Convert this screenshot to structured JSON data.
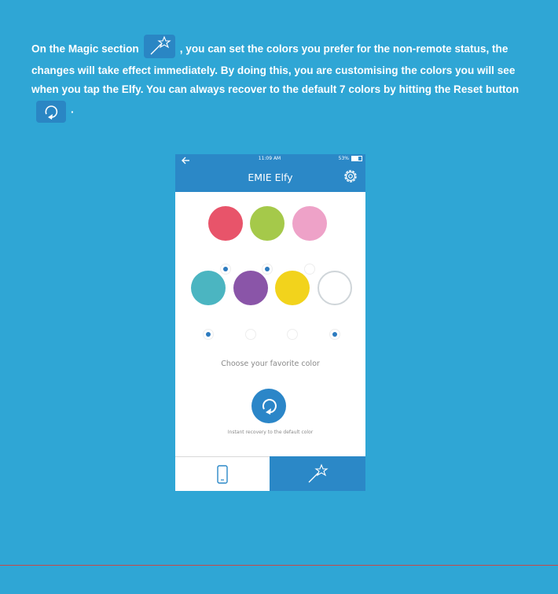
{
  "instructions": {
    "part1": "On the Magic section",
    "part2": ", you can set the colors you prefer for the non-remote status, the changes will take effect immediately. By doing this, you are customising the colors you will see when you tap the Elfy. You can always recover to the default 7 colors by hitting the Reset button",
    "part3": ".",
    "magic_icon": "magic-wand-icon",
    "reset_icon": "reset-icon"
  },
  "phone": {
    "status_time": "11:09 AM",
    "status_battery": "53%",
    "app_title": "EMIE Elfy",
    "settings_icon": "gear-icon",
    "colors": [
      {
        "color": "#e8546a",
        "selected": true
      },
      {
        "color": "#a5c94a",
        "selected": true
      },
      {
        "color": "#eea2c8",
        "selected": false
      },
      {
        "color": "#4bb5c1",
        "selected": true
      },
      {
        "color": "#8a55a8",
        "selected": false
      },
      {
        "color": "#f2d31c",
        "selected": false
      },
      {
        "color": "#ffffff",
        "selected": true
      }
    ],
    "choose_label": "Choose your favorite color",
    "recovery_label": "Instant recovery to the default color",
    "tabs": [
      {
        "icon": "phone-icon",
        "active": false
      },
      {
        "icon": "magic-wand-icon",
        "active": true
      }
    ]
  },
  "colors": {
    "background": "#2fa6d5",
    "header_blue": "#2b88c7",
    "divider": "#c54a4a"
  }
}
